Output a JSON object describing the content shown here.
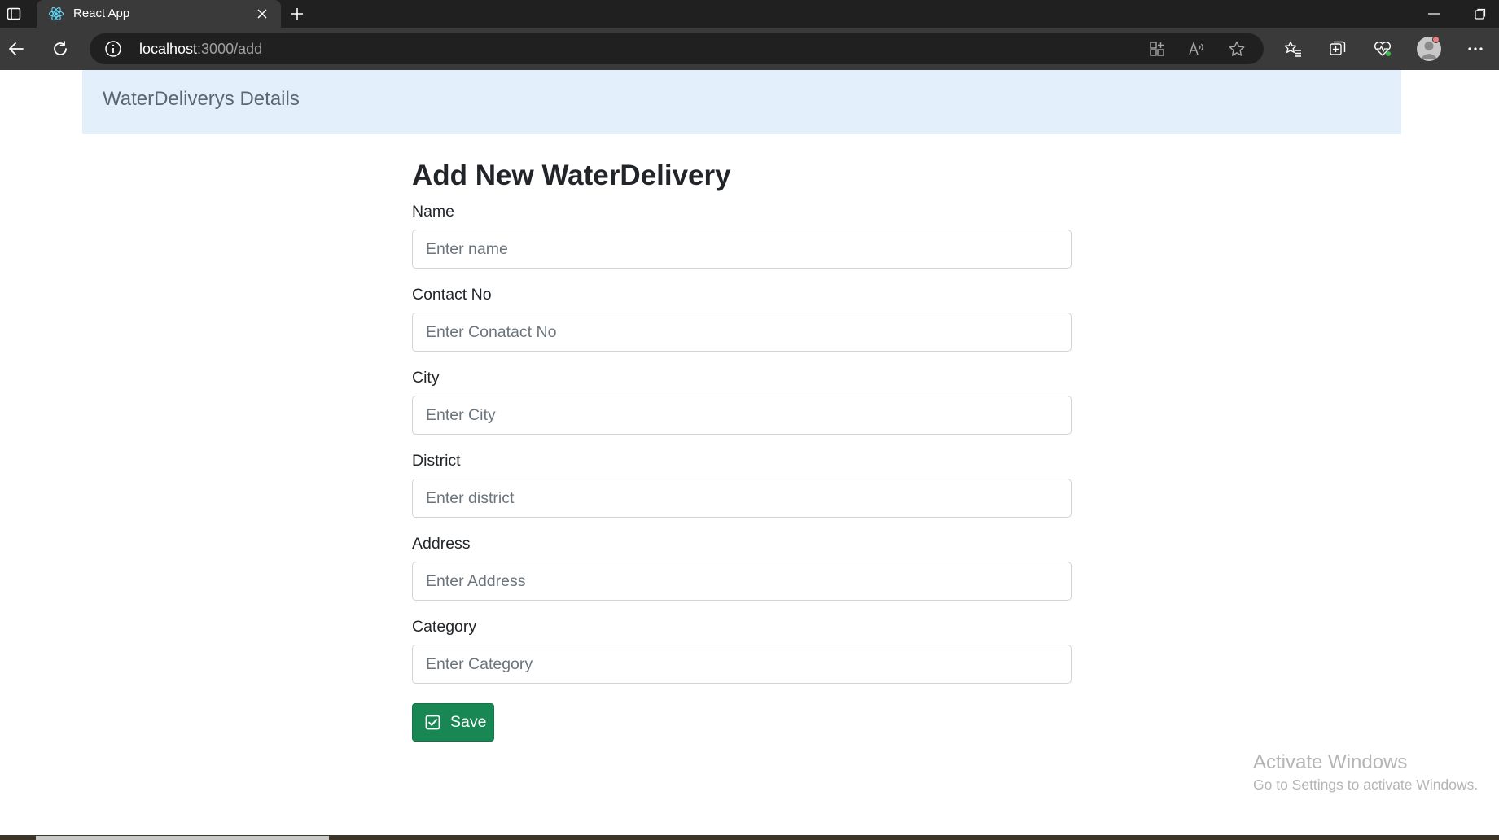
{
  "browser": {
    "tab_title": "React App",
    "url_host": "localhost",
    "url_path": ":3000/add"
  },
  "header": {
    "brand": "WaterDeliverys Details"
  },
  "form": {
    "title": "Add New WaterDelivery",
    "fields": [
      {
        "label": "Name",
        "placeholder": "Enter name",
        "value": ""
      },
      {
        "label": "Contact No",
        "placeholder": "Enter Conatact No",
        "value": ""
      },
      {
        "label": "City",
        "placeholder": "Enter City",
        "value": ""
      },
      {
        "label": "District",
        "placeholder": "Enter district",
        "value": ""
      },
      {
        "label": "Address",
        "placeholder": "Enter Address",
        "value": ""
      },
      {
        "label": "Category",
        "placeholder": "Enter Category",
        "value": ""
      }
    ],
    "save_label": "Save"
  },
  "watermark": {
    "title": "Activate Windows",
    "subtitle": "Go to Settings to activate Windows."
  },
  "colors": {
    "header_bg": "#e3f0fc",
    "save_button": "#198754",
    "browser_dark": "#202020"
  },
  "icons": {
    "tab_actions": "tab-actions-icon",
    "favicon": "react-icon",
    "tab_close": "close-icon",
    "new_tab": "plus-icon",
    "back": "back-arrow-icon",
    "refresh": "refresh-icon",
    "site_info": "info-icon",
    "save": "checkbox-check-icon"
  }
}
